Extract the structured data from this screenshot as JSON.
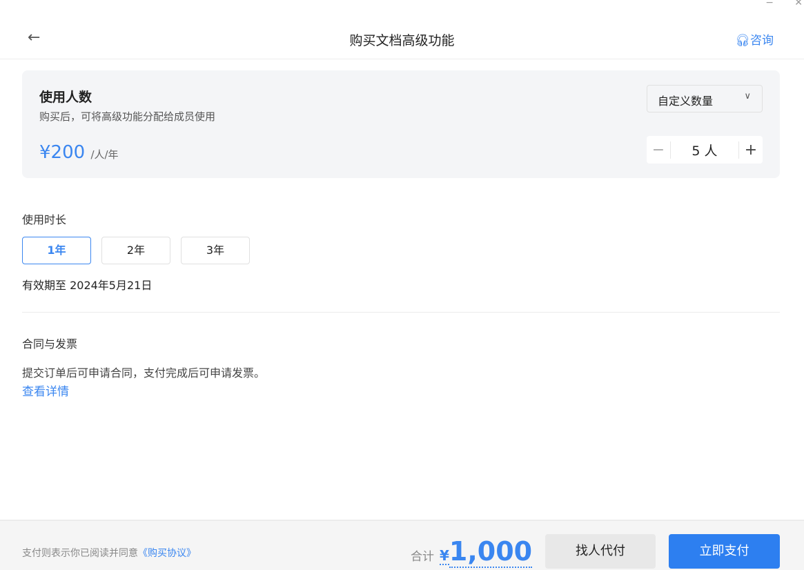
{
  "window": {
    "minimize": "−",
    "close": "✕"
  },
  "header": {
    "title": "购买文档高级功能",
    "consult": "咨询"
  },
  "seats": {
    "title": "使用人数",
    "subtitle": "购买后，可将高级功能分配给成员使用",
    "price": "¥200",
    "unit": "/人/年",
    "select_value": "自定义数量",
    "quantity": "5 人"
  },
  "duration": {
    "label": "使用时长",
    "options": [
      "1年",
      "2年",
      "3年"
    ],
    "selected": "1年",
    "expiry": "有效期至 2024年5月21日"
  },
  "contract": {
    "label": "合同与发票",
    "text": "提交订单后可申请合同，支付完成后可申请发票。",
    "link": "查看详情"
  },
  "footer": {
    "agree": "支付则表示你已阅读并同意",
    "agreement_link": "《购买协议》",
    "total_label": "合计",
    "currency": "¥",
    "total": "1,000",
    "proxy_pay": "找人代付",
    "pay_now": "立即支付"
  },
  "colors": {
    "accent": "#2d7ff0"
  }
}
